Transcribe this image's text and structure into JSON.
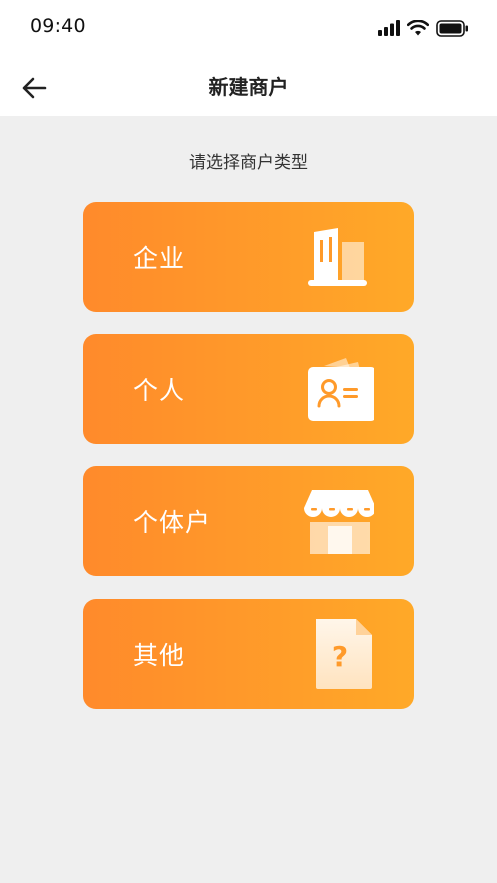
{
  "status_bar": {
    "time": "09:40",
    "icons": [
      "signal-icon",
      "wifi-icon",
      "battery-icon"
    ]
  },
  "nav": {
    "title": "新建商户",
    "back_icon": "arrow-left-icon"
  },
  "prompt": "请选择商户类型",
  "options": [
    {
      "label": "企业",
      "icon": "building-icon"
    },
    {
      "label": "个人",
      "icon": "id-card-icon"
    },
    {
      "label": "个体户",
      "icon": "storefront-icon"
    },
    {
      "label": "其他",
      "icon": "question-document-icon"
    }
  ],
  "colors": {
    "card_gradient_start": "#ff8a2b",
    "card_gradient_end": "#ffa928",
    "background": "#efefef",
    "header": "#ffffff"
  }
}
